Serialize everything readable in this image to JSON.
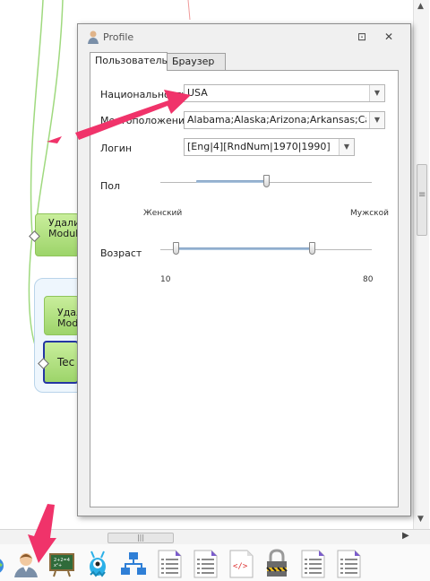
{
  "canvas": {
    "nodes": [
      {
        "line1": "Удали",
        "line2": "Module"
      },
      {
        "line1": "Удал",
        "line2": "Modu"
      },
      {
        "line1": "Tec",
        "line2": ""
      }
    ]
  },
  "dialog": {
    "title": "Profile",
    "tabs": [
      "Пользователь",
      "Браузер"
    ],
    "nationality": {
      "label": "Национальность",
      "value": "USA"
    },
    "location": {
      "label": "Местоположение",
      "value": "Alabama;Alaska;Arizona;Arkansas;California"
    },
    "login": {
      "label": "Логин",
      "value": "[Eng|4][RndNum|1970|1990]"
    },
    "gender": {
      "label": "Пол",
      "min_label": "Женский",
      "max_label": "Мужской",
      "value_fraction": 0.5
    },
    "age": {
      "label": "Возраст",
      "min": "10",
      "max": "80",
      "range": [
        15,
        60
      ]
    }
  },
  "toolbar": {
    "icons": [
      "globe-icon",
      "user-profile-icon",
      "chalkboard-icon",
      "monster-icon",
      "network-icon",
      "list-document-icon",
      "list-document-icon",
      "code-document-icon",
      "lock-icon",
      "list-document-icon",
      "list-document-icon"
    ]
  },
  "colors": {
    "accent_arrow": "#f0336a",
    "node_green": "#a9dc74",
    "selection_blue": "#2436a3"
  }
}
